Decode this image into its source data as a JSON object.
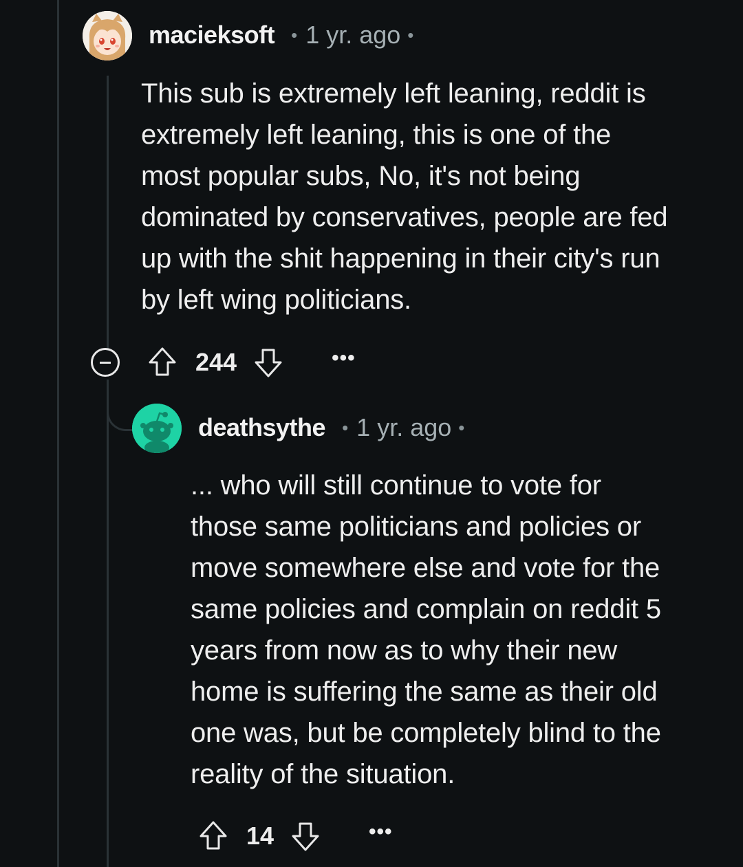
{
  "comments": [
    {
      "username": "macieksoft",
      "separator": "•",
      "time": "1 yr. ago",
      "trailing_dot": "•",
      "avatar_icon": "anime-fox-girl-avatar",
      "body_lines": [
        "This sub is extremely left leaning, reddit is",
        "extremely left leaning, this is one of the",
        "most popular subs, No, it's not being",
        "dominated by conservatives, people are fed",
        "up with the shit happening in their city's run",
        "by left wing politicians."
      ],
      "score": "244",
      "more": "•••"
    },
    {
      "username": "deathsythe",
      "separator": "•",
      "time": "1 yr. ago",
      "trailing_dot": "•",
      "avatar_icon": "snoo-default-avatar",
      "avatar_color": "#1ed3a5",
      "body_lines": [
        "... who will still continue to vote for",
        "those same politicians and policies or",
        "move somewhere else and vote for the",
        "same policies and complain on reddit 5",
        "years from now as to why their new",
        "home is suffering the same as their old",
        "one was, but be completely blind to the",
        "reality of the situation."
      ],
      "score": "14",
      "more": "•••"
    }
  ]
}
